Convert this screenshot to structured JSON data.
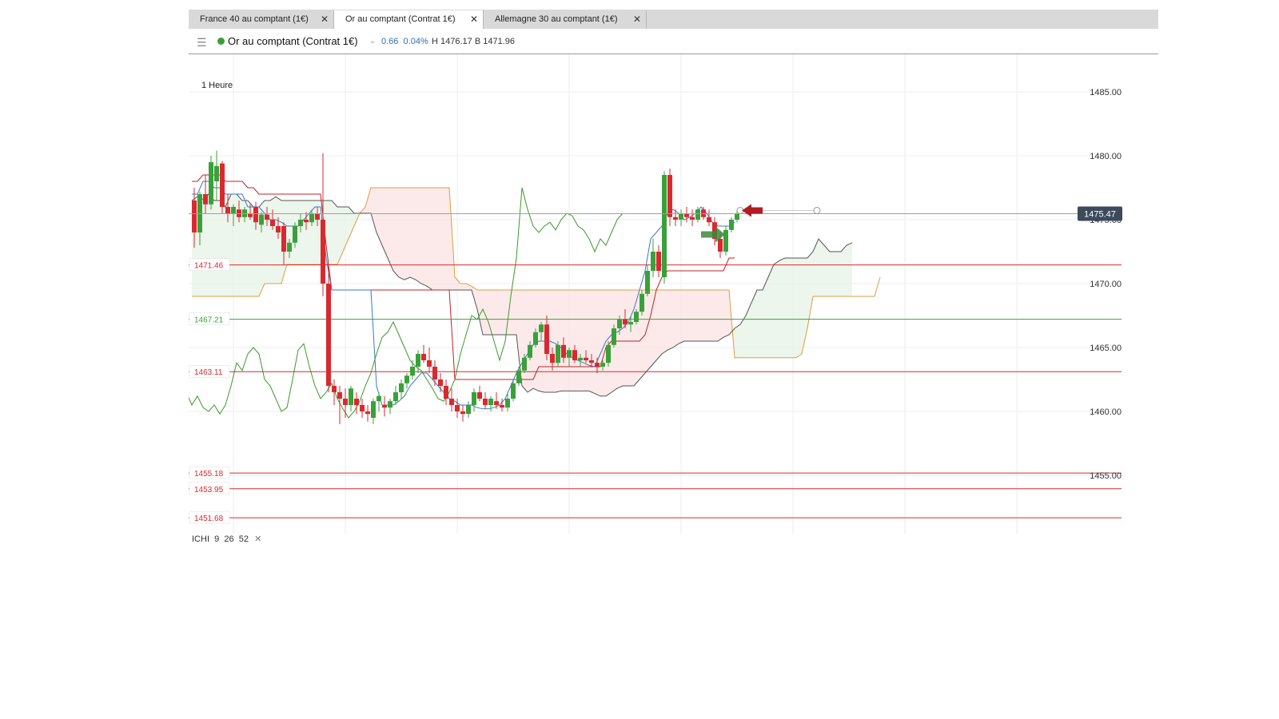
{
  "tabs": [
    {
      "label": "France 40 au comptant (1€)",
      "close": "✕",
      "active": false
    },
    {
      "label": "Or au comptant (Contrat 1€)",
      "close": "✕",
      "active": true
    },
    {
      "label": "Allemagne 30 au comptant (1€)",
      "close": "✕",
      "active": false
    }
  ],
  "toolbar": {
    "menu_icon": "hamburger-icon",
    "status_color": "#3aa13a",
    "instrument": "Or au comptant (Contrat 1€)",
    "chevron": "⌄",
    "change": "0.66",
    "change_pct": "0.04%",
    "high_low": "H 1476.17  B 1471.96"
  },
  "chart_data": {
    "type": "candlestick",
    "timeframe": "1 Heure",
    "ylim": [
      1450.9,
      1488.1
    ],
    "y_ticks": [
      "1485.00",
      "1480.00",
      "1475.00",
      "1470.00",
      "1465.00",
      "1460.00",
      "1455.00"
    ],
    "last_price": "1475.47",
    "grid": true,
    "colors": {
      "up": "#3aa13a",
      "down": "#d9292f",
      "tenkan": "#3b78c4",
      "kijun": "#c0202a",
      "chikou": "#3a9a2a",
      "span_a": "#555555",
      "span_b": "#d9a040"
    },
    "horizontal_levels": [
      {
        "value": 1471.46,
        "label": "1471.46",
        "color": "#d9292f"
      },
      {
        "value": 1467.21,
        "label": "1467.21",
        "color": "#3aa13a"
      },
      {
        "value": 1463.11,
        "label": "1463.11",
        "color": "#d9292f"
      },
      {
        "value": 1455.18,
        "label": "1455.18",
        "color": "#d9292f"
      },
      {
        "value": 1453.95,
        "label": "1453.95",
        "color": "#d9292f"
      },
      {
        "value": 1451.68,
        "label": "1451.68",
        "color": "#d9292f"
      }
    ],
    "candles_ohlc": [
      [
        1476.5,
        1477.5,
        1472.8,
        1474.0
      ],
      [
        1474.0,
        1477.2,
        1473.0,
        1477.0
      ],
      [
        1477.0,
        1478.5,
        1475.5,
        1476.2
      ],
      [
        1476.2,
        1480.0,
        1475.8,
        1479.5
      ],
      [
        1478.0,
        1480.4,
        1476.5,
        1479.2
      ],
      [
        1479.4,
        1479.6,
        1475.5,
        1476.0
      ],
      [
        1476.0,
        1477.0,
        1474.8,
        1475.5
      ],
      [
        1475.5,
        1476.2,
        1474.5,
        1476.0
      ],
      [
        1475.8,
        1476.5,
        1474.8,
        1475.2
      ],
      [
        1475.2,
        1476.0,
        1474.8,
        1475.8
      ],
      [
        1475.5,
        1476.2,
        1475.0,
        1475.2
      ],
      [
        1476.0,
        1476.4,
        1474.2,
        1474.8
      ],
      [
        1474.6,
        1475.6,
        1474.0,
        1475.4
      ],
      [
        1475.4,
        1476.0,
        1474.5,
        1475.0
      ],
      [
        1475.0,
        1475.8,
        1474.2,
        1474.5
      ],
      [
        1474.5,
        1475.2,
        1473.5,
        1474.0
      ],
      [
        1474.5,
        1474.8,
        1471.5,
        1472.5
      ],
      [
        1472.5,
        1473.5,
        1472.0,
        1473.2
      ],
      [
        1473.2,
        1474.8,
        1472.8,
        1474.5
      ],
      [
        1474.5,
        1475.5,
        1474.0,
        1475.0
      ],
      [
        1475.0,
        1475.6,
        1474.2,
        1474.8
      ],
      [
        1474.8,
        1475.8,
        1474.5,
        1475.5
      ],
      [
        1475.5,
        1476.0,
        1474.5,
        1475.0
      ],
      [
        1475.0,
        1480.2,
        1469.0,
        1470.0
      ],
      [
        1470.0,
        1471.5,
        1461.5,
        1462.0
      ],
      [
        1462.0,
        1462.5,
        1460.5,
        1461.5
      ],
      [
        1461.5,
        1462.0,
        1459.0,
        1461.0
      ],
      [
        1461.0,
        1461.8,
        1459.5,
        1460.5
      ],
      [
        1460.5,
        1462.0,
        1460.0,
        1461.8
      ],
      [
        1461.0,
        1461.5,
        1459.8,
        1460.5
      ],
      [
        1460.5,
        1461.0,
        1459.5,
        1460.0
      ],
      [
        1460.0,
        1460.5,
        1459.2,
        1459.8
      ],
      [
        1459.5,
        1461.0,
        1459.0,
        1460.8
      ],
      [
        1460.8,
        1461.5,
        1460.0,
        1461.2
      ],
      [
        1460.5,
        1461.2,
        1459.6,
        1460.3
      ],
      [
        1460.3,
        1461.0,
        1459.8,
        1460.8
      ],
      [
        1460.8,
        1462.0,
        1460.5,
        1461.5
      ],
      [
        1461.5,
        1462.5,
        1461.0,
        1462.2
      ],
      [
        1462.2,
        1463.0,
        1461.8,
        1462.8
      ],
      [
        1462.8,
        1464.0,
        1462.5,
        1463.5
      ],
      [
        1463.5,
        1464.8,
        1463.0,
        1464.5
      ],
      [
        1464.5,
        1465.2,
        1463.8,
        1464.0
      ],
      [
        1464.0,
        1465.0,
        1463.0,
        1463.5
      ],
      [
        1463.5,
        1464.0,
        1462.0,
        1462.5
      ],
      [
        1462.5,
        1463.0,
        1461.5,
        1462.0
      ],
      [
        1462.0,
        1462.5,
        1460.5,
        1461.0
      ],
      [
        1461.0,
        1461.8,
        1460.0,
        1460.5
      ],
      [
        1460.5,
        1461.0,
        1459.5,
        1460.0
      ],
      [
        1460.0,
        1460.5,
        1459.2,
        1459.8
      ],
      [
        1459.8,
        1460.8,
        1459.5,
        1460.5
      ],
      [
        1460.5,
        1461.8,
        1460.0,
        1461.5
      ],
      [
        1461.5,
        1462.0,
        1460.8,
        1461.0
      ],
      [
        1461.0,
        1461.5,
        1460.2,
        1460.5
      ],
      [
        1460.5,
        1461.2,
        1460.0,
        1461.0
      ],
      [
        1460.8,
        1461.5,
        1460.2,
        1460.5
      ],
      [
        1460.5,
        1461.0,
        1460.0,
        1460.3
      ],
      [
        1460.3,
        1461.5,
        1460.0,
        1461.0
      ],
      [
        1461.0,
        1462.5,
        1460.8,
        1462.2
      ],
      [
        1462.2,
        1463.5,
        1462.0,
        1463.2
      ],
      [
        1463.2,
        1464.5,
        1463.0,
        1464.2
      ],
      [
        1464.2,
        1465.5,
        1464.0,
        1465.2
      ],
      [
        1465.2,
        1466.5,
        1465.0,
        1466.2
      ],
      [
        1466.2,
        1467.0,
        1465.5,
        1466.8
      ],
      [
        1466.8,
        1467.5,
        1464.0,
        1464.5
      ],
      [
        1464.5,
        1465.0,
        1463.2,
        1463.8
      ],
      [
        1463.8,
        1465.5,
        1463.5,
        1465.2
      ],
      [
        1465.2,
        1465.8,
        1463.8,
        1464.2
      ],
      [
        1464.2,
        1465.0,
        1463.5,
        1464.8
      ],
      [
        1464.8,
        1465.2,
        1463.8,
        1464.0
      ],
      [
        1464.0,
        1464.5,
        1463.5,
        1464.2
      ],
      [
        1464.2,
        1464.8,
        1463.8,
        1464.0
      ],
      [
        1464.0,
        1464.5,
        1463.5,
        1463.8
      ],
      [
        1463.8,
        1464.2,
        1463.0,
        1463.5
      ],
      [
        1463.5,
        1464.0,
        1463.2,
        1463.8
      ],
      [
        1463.8,
        1465.5,
        1463.5,
        1465.2
      ],
      [
        1465.2,
        1466.8,
        1465.0,
        1466.5
      ],
      [
        1466.5,
        1467.5,
        1466.0,
        1467.2
      ],
      [
        1467.2,
        1468.0,
        1466.5,
        1466.8
      ],
      [
        1466.8,
        1467.5,
        1466.2,
        1467.0
      ],
      [
        1467.0,
        1468.0,
        1466.8,
        1467.8
      ],
      [
        1467.8,
        1469.5,
        1467.5,
        1469.2
      ],
      [
        1469.2,
        1471.5,
        1469.0,
        1471.0
      ],
      [
        1471.0,
        1473.5,
        1470.5,
        1472.5
      ],
      [
        1472.5,
        1473.0,
        1470.5,
        1471.0
      ],
      [
        1470.5,
        1478.8,
        1470.0,
        1478.5
      ],
      [
        1478.5,
        1479.0,
        1474.5,
        1475.2
      ],
      [
        1475.2,
        1475.8,
        1474.5,
        1475.0
      ],
      [
        1475.0,
        1475.8,
        1474.5,
        1475.5
      ],
      [
        1475.5,
        1476.0,
        1474.8,
        1475.2
      ],
      [
        1475.2,
        1475.8,
        1474.5,
        1475.0
      ],
      [
        1475.0,
        1476.0,
        1474.8,
        1475.8
      ],
      [
        1475.8,
        1476.0,
        1475.0,
        1475.2
      ],
      [
        1475.2,
        1475.8,
        1474.5,
        1474.8
      ],
      [
        1474.8,
        1475.2,
        1473.0,
        1473.5
      ],
      [
        1473.5,
        1474.0,
        1472.0,
        1472.5
      ],
      [
        1472.5,
        1474.5,
        1472.2,
        1474.2
      ],
      [
        1474.2,
        1475.2,
        1474.0,
        1475.0
      ],
      [
        1475.0,
        1475.8,
        1474.8,
        1475.47
      ]
    ],
    "tenkan": [
      1477.0,
      1477.0,
      1478.0,
      1478.0,
      1477.5,
      1477.5,
      1477.0,
      1477.0,
      1477.0,
      1477.0,
      1476.0,
      1476.0,
      1476.0,
      1475.5,
      1475.0,
      1475.0,
      1474.8,
      1474.5,
      1474.5,
      1474.5,
      1475.0,
      1475.5,
      1476.0,
      1476.0,
      1472.0,
      1469.5,
      1469.5,
      1469.5,
      1469.5,
      1469.5,
      1469.5,
      1469.5,
      1469.5,
      1462.0,
      1460.5,
      1460.5,
      1460.5,
      1460.8,
      1461.2,
      1462.0,
      1462.5,
      1463.0,
      1463.0,
      1462.5,
      1462.0,
      1461.5,
      1461.0,
      1460.8,
      1460.5,
      1460.5,
      1460.5,
      1460.3,
      1460.2,
      1460.2,
      1460.3,
      1460.5,
      1461.0,
      1462.0,
      1463.0,
      1463.8,
      1464.5,
      1465.2,
      1465.5,
      1465.5,
      1465.5,
      1465.3,
      1465.0,
      1464.5,
      1464.2,
      1464.0,
      1463.8,
      1463.6,
      1463.5,
      1464.5,
      1465.5,
      1466.0,
      1466.2,
      1466.5,
      1467.0,
      1468.0,
      1469.5,
      1471.0,
      1473.5,
      1474.0,
      1474.5,
      1475.5,
      1475.8,
      1475.5,
      1475.0,
      1475.2,
      1475.5,
      1476.0,
      1475.5,
      1474.8,
      1474.5,
      1474.5,
      1474.5,
      1474.8
    ],
    "kijun": [
      1478.0,
      1478.0,
      1478.5,
      1478.5,
      1478.5,
      1478.5,
      1478.0,
      1478.0,
      1478.0,
      1478.0,
      1477.5,
      1477.5,
      1477.0,
      1477.0,
      1477.0,
      1477.0,
      1477.0,
      1477.0,
      1477.0,
      1477.0,
      1477.0,
      1477.0,
      1477.0,
      1477.0,
      1473.0,
      1469.5,
      1469.5,
      1469.5,
      1469.5,
      1469.5,
      1469.5,
      1469.5,
      1469.5,
      1469.5,
      1469.5,
      1469.5,
      1469.5,
      1469.5,
      1469.5,
      1469.5,
      1469.5,
      1469.5,
      1469.5,
      1469.5,
      1469.5,
      1469.5,
      1469.5,
      1462.5,
      1462.5,
      1462.5,
      1462.5,
      1462.5,
      1462.5,
      1462.5,
      1462.5,
      1462.5,
      1462.5,
      1462.5,
      1462.5,
      1462.5,
      1462.5,
      1462.5,
      1463.5,
      1463.5,
      1463.5,
      1463.5,
      1463.5,
      1463.5,
      1463.5,
      1463.5,
      1463.5,
      1463.5,
      1463.5,
      1463.5,
      1465.0,
      1465.5,
      1465.5,
      1465.5,
      1465.5,
      1465.5,
      1465.5,
      1466.0,
      1467.5,
      1469.5,
      1470.5,
      1471.0,
      1471.0,
      1471.0,
      1471.0,
      1471.0,
      1471.0,
      1471.0,
      1471.0,
      1471.0,
      1471.0,
      1471.0,
      1472.0,
      1472.0
    ],
    "chikou": [
      1461.5,
      1460.5,
      1461.2,
      1460.3,
      1460.0,
      1460.5,
      1459.8,
      1460.5,
      1462.0,
      1463.8,
      1463.2,
      1464.5,
      1465.0,
      1464.5,
      1462.5,
      1462.0,
      1461.0,
      1460.0,
      1460.3,
      1462.5,
      1464.8,
      1465.3,
      1463.5,
      1462.0,
      1461.0,
      1461.5,
      1462.2,
      1461.0,
      1460.2,
      1459.5,
      1460.0,
      1460.8,
      1462.0,
      1463.0,
      1464.5,
      1465.8,
      1466.2,
      1467.0,
      1466.0,
      1465.0,
      1464.0,
      1463.5,
      1463.2,
      1462.5,
      1461.8,
      1461.0,
      1460.8,
      1461.5,
      1462.5,
      1464.5,
      1466.0,
      1467.5,
      1467.2,
      1468.0,
      1467.0,
      1465.5,
      1464.0,
      1465.5,
      1469.0,
      1472.0,
      1477.5,
      1475.8,
      1474.5,
      1474.0,
      1474.5,
      1474.8,
      1474.2,
      1475.0,
      1475.5,
      1475.3,
      1474.5,
      1474.2,
      1473.5,
      1472.5,
      1473.5,
      1473.0,
      1474.0,
      1475.0,
      1475.5
    ],
    "span_a": [
      1476.5,
      1476.8,
      1476.6,
      1477.0,
      1476.5,
      1476.5,
      1476.0,
      1477.0,
      1477.0,
      1476.5,
      1476.5,
      1476.0,
      1476.0,
      1476.5,
      1476.5,
      1476.8,
      1476.5,
      1476.5,
      1476.5,
      1476.5,
      1476.5,
      1476.5,
      1476.5,
      1476.5,
      1476.5,
      1476.5,
      1476.0,
      1476.0,
      1476.0,
      1475.5,
      1475.5,
      1475.5,
      1475.5,
      1474.0,
      1473.0,
      1472.0,
      1471.0,
      1470.5,
      1470.3,
      1470.5,
      1470.3,
      1470.0,
      1469.8,
      1469.5,
      1469.5,
      1469.5,
      1469.5,
      1469.5,
      1469.5,
      1469.5,
      1469.5,
      1468.0,
      1466.0,
      1466.0,
      1466.0,
      1466.0,
      1466.0,
      1466.0,
      1466.0,
      1462.0,
      1461.5,
      1461.8,
      1461.6,
      1461.5,
      1461.5,
      1461.5,
      1461.6,
      1461.6,
      1461.6,
      1461.6,
      1461.6,
      1461.6,
      1461.4,
      1461.2,
      1461.2,
      1461.5,
      1461.8,
      1462.0,
      1462.0,
      1462.0,
      1462.5,
      1463.0,
      1463.5,
      1464.0,
      1464.5,
      1464.8,
      1465.0,
      1465.3,
      1465.5,
      1465.5,
      1465.5,
      1465.5,
      1465.5,
      1465.5,
      1465.5,
      1465.8,
      1466.0,
      1466.5,
      1466.8,
      1467.5,
      1468.5,
      1469.5,
      1469.5,
      1470.5,
      1471.5,
      1471.8,
      1472.0,
      1472.0,
      1472.0,
      1472.0,
      1472.0,
      1472.5,
      1473.5,
      1473.0,
      1472.5,
      1472.5,
      1472.5,
      1473.0,
      1473.2
    ],
    "span_b": [
      1469.0,
      1469.0,
      1469.0,
      1469.0,
      1469.0,
      1469.0,
      1469.0,
      1469.0,
      1469.0,
      1469.0,
      1469.0,
      1469.0,
      1469.0,
      1470.0,
      1470.0,
      1470.0,
      1470.0,
      1471.5,
      1471.5,
      1471.5,
      1471.5,
      1471.5,
      1471.5,
      1471.5,
      1471.5,
      1471.5,
      1471.5,
      1472.5,
      1473.5,
      1474.5,
      1475.5,
      1476.0,
      1477.5,
      1477.5,
      1477.5,
      1477.5,
      1477.5,
      1477.5,
      1477.5,
      1477.5,
      1477.5,
      1477.5,
      1477.5,
      1477.5,
      1477.5,
      1477.5,
      1477.5,
      1470.5,
      1470.0,
      1470.0,
      1469.8,
      1469.5,
      1469.5,
      1469.5,
      1469.5,
      1469.5,
      1469.5,
      1469.5,
      1469.5,
      1469.5,
      1469.5,
      1469.5,
      1469.5,
      1469.5,
      1469.5,
      1469.5,
      1469.5,
      1469.5,
      1469.5,
      1469.5,
      1469.5,
      1469.5,
      1469.5,
      1469.5,
      1469.5,
      1469.5,
      1469.5,
      1469.5,
      1469.5,
      1469.5,
      1469.5,
      1469.5,
      1469.5,
      1469.5,
      1469.5,
      1469.5,
      1469.5,
      1469.5,
      1469.5,
      1469.5,
      1469.5,
      1469.5,
      1469.5,
      1469.5,
      1469.5,
      1469.5,
      1469.5,
      1464.2,
      1464.2,
      1464.2,
      1464.2,
      1464.2,
      1464.2,
      1464.2,
      1464.2,
      1464.2,
      1464.2,
      1464.2,
      1464.2,
      1464.5,
      1466.5,
      1469.0,
      1469.0,
      1469.0,
      1469.0,
      1469.0,
      1469.0,
      1469.0,
      1469.0,
      1469.0,
      1469.0,
      1469.0,
      1469.0,
      1470.5
    ]
  },
  "indicator": {
    "name": "ICHI",
    "p1": "9",
    "p2": "26",
    "p3": "52",
    "close": "✕"
  }
}
